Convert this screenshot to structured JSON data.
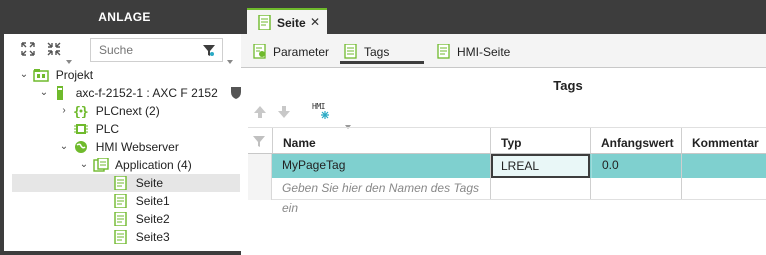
{
  "sidebar": {
    "title": "ANLAGE",
    "search_placeholder": "Suche",
    "tree": [
      {
        "label": "Projekt",
        "level": 0,
        "expanded": true
      },
      {
        "label": "axc-f-2152-1 : AXC F 2152",
        "level": 1,
        "expanded": true
      },
      {
        "label": "PLCnext (2)",
        "level": 2,
        "expanded": false
      },
      {
        "label": "PLC",
        "level": 2
      },
      {
        "label": "HMI Webserver",
        "level": 2,
        "expanded": true
      },
      {
        "label": "Application (4)",
        "level": 3,
        "expanded": true
      },
      {
        "label": "Seite",
        "level": 4,
        "selected": true
      },
      {
        "label": "Seite1",
        "level": 4
      },
      {
        "label": "Seite2",
        "level": 4
      },
      {
        "label": "Seite3",
        "level": 4
      }
    ]
  },
  "document_tab": {
    "label": "Seite",
    "close": "✕"
  },
  "subtabs": [
    {
      "label": "Parameter",
      "active": false
    },
    {
      "label": "Tags",
      "active": true
    },
    {
      "label": "HMI-Seite",
      "active": false
    }
  ],
  "editor": {
    "title": "Tags",
    "toolbar_hmi_label": "HMI",
    "columns": [
      "Name",
      "Typ",
      "Anfangswert",
      "Kommentar"
    ],
    "rows": [
      {
        "name": "MyPageTag",
        "typ": "LREAL",
        "anfangswert": "0.0",
        "kommentar": ""
      }
    ],
    "new_row_placeholder": "Geben Sie hier den Namen des Tags ein"
  },
  "colors": {
    "accent_green": "#6fba2c",
    "dark_bar": "#3d3d3d",
    "selected_row": "#7fd0cf",
    "tree_selection": "#e6e6e6"
  }
}
